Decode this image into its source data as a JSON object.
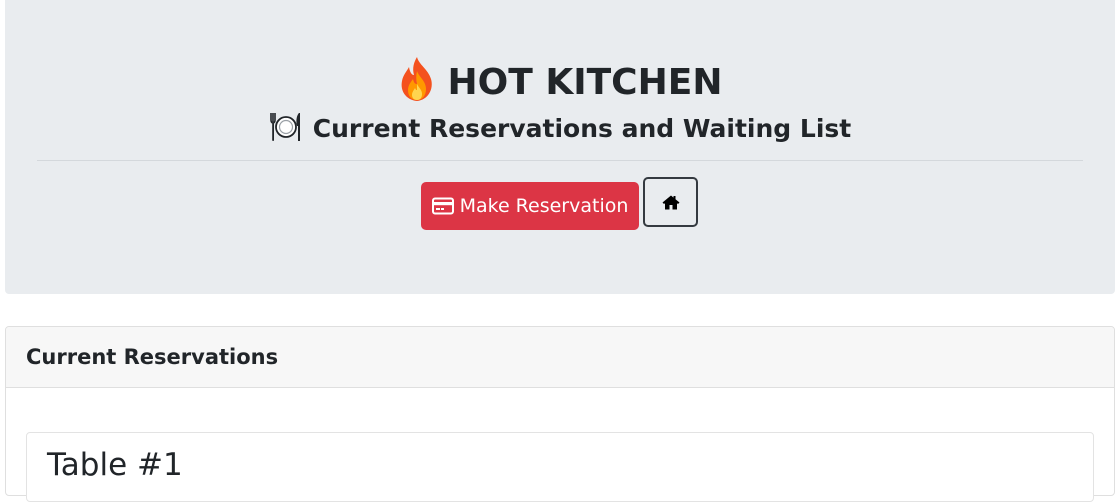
{
  "header": {
    "brand_title": "HOT KITCHEN",
    "brand_icon": "fire-icon",
    "subtitle": "Current Reservations and Waiting List",
    "subtitle_icon": "plate-cutlery-icon",
    "make_reservation_label": "Make Reservation",
    "make_reservation_icon": "credit-card-icon",
    "home_icon": "home-icon"
  },
  "reservations": {
    "header_title": "Current Reservations",
    "tables": [
      {
        "title": "Table #1"
      }
    ]
  },
  "colors": {
    "jumbotron_bg": "#e9ecef",
    "danger": "#dc3545",
    "text": "#212529",
    "card_header_bg": "#f7f7f7"
  }
}
